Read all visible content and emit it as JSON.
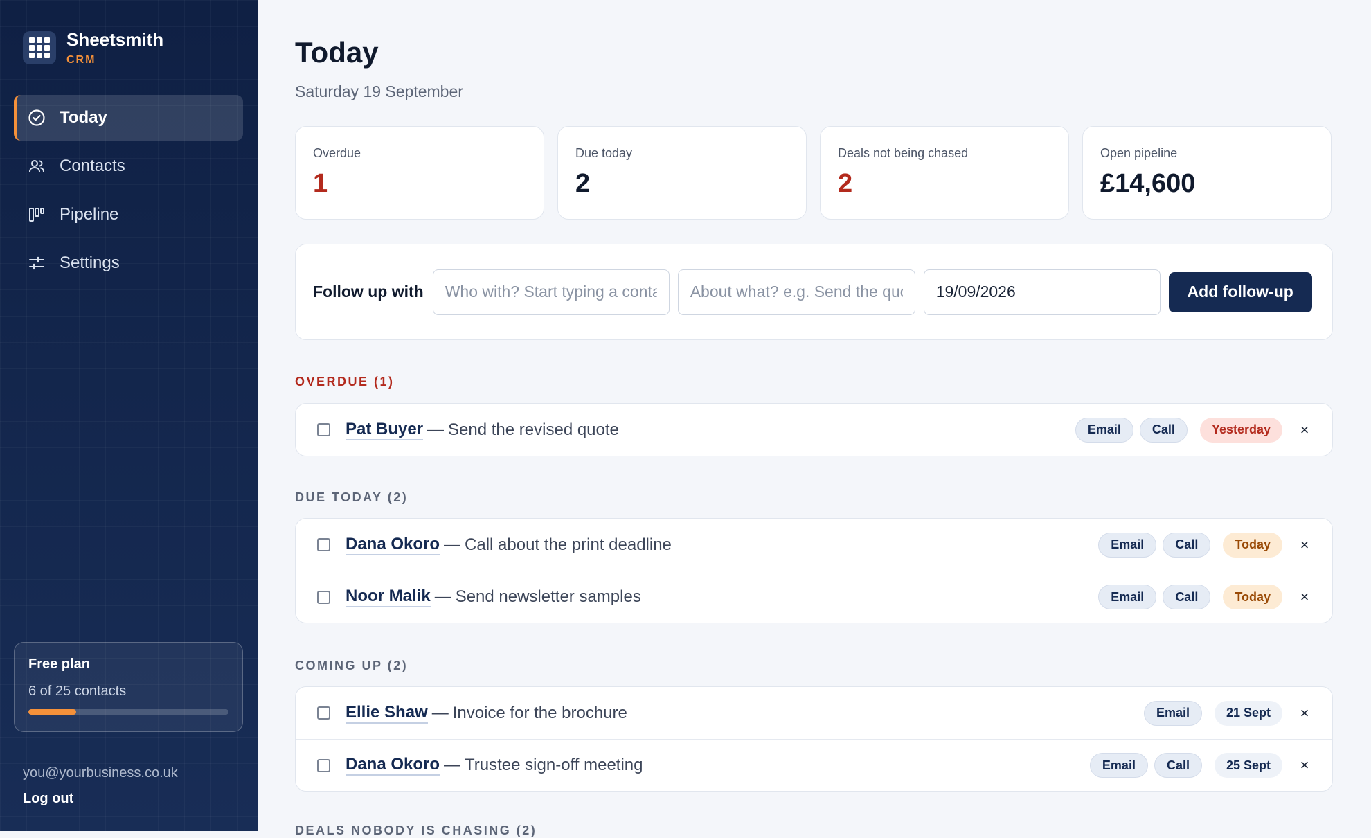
{
  "colors": {
    "sidebar": "#13254a",
    "accent": "#f5913a",
    "danger": "#b32a1d",
    "primary": "#152a52"
  },
  "brand": {
    "name": "Sheetsmith",
    "sub": "CRM",
    "icon": "grid-icon"
  },
  "nav": [
    {
      "label": "Today",
      "icon": "check-circle-icon",
      "active": true
    },
    {
      "label": "Contacts",
      "icon": "users-icon",
      "active": false
    },
    {
      "label": "Pipeline",
      "icon": "kanban-icon",
      "active": false
    },
    {
      "label": "Settings",
      "icon": "sliders-icon",
      "active": false
    }
  ],
  "plan": {
    "title": "Free plan",
    "count": "6 of 25 contacts",
    "used": 6,
    "limit": 25
  },
  "account": {
    "email": "you@yourbusiness.co.uk",
    "logout": "Log out"
  },
  "page": {
    "title": "Today",
    "date": "Saturday 19 September"
  },
  "stats": [
    {
      "label": "Overdue",
      "value": "1"
    },
    {
      "label": "Due today",
      "value": "2"
    },
    {
      "label": "Deals not being chased",
      "value": "2"
    },
    {
      "label": "Open pipeline",
      "value": "£14,600"
    }
  ],
  "follow_up": {
    "label": "Follow up with",
    "who_placeholder": "Who with? Start typing a contact name",
    "what_placeholder": "About what? e.g. Send the quote",
    "date_value": "19/09/2026",
    "button": "Add follow-up"
  },
  "sections": {
    "overdue": "OVERDUE (1)",
    "due_today": "DUE TODAY (2)",
    "coming_up": "COMING UP (2)",
    "nobody": "DEALS NOBODY IS CHASING (2)"
  },
  "task_separator": "—",
  "dismiss_symbol": "×",
  "tasks": {
    "overdue": [
      {
        "name": "Pat Buyer",
        "what": "Send the revised quote",
        "email": "Email",
        "call": "Call",
        "due": "Yesterday"
      }
    ],
    "due_today": [
      {
        "name": "Dana Okoro",
        "what": "Call about the print deadline",
        "email": "Email",
        "call": "Call",
        "due": "Today"
      },
      {
        "name": "Noor Malik",
        "what": "Send newsletter samples",
        "email": "Email",
        "call": "Call",
        "due": "Today"
      }
    ],
    "coming_up": [
      {
        "name": "Ellie Shaw",
        "what": "Invoice for the brochure",
        "email": "Email",
        "due": "21 Sept"
      },
      {
        "name": "Dana Okoro",
        "what": "Trustee sign-off meeting",
        "email": "Email",
        "call": "Call",
        "due": "25 Sept"
      }
    ]
  }
}
